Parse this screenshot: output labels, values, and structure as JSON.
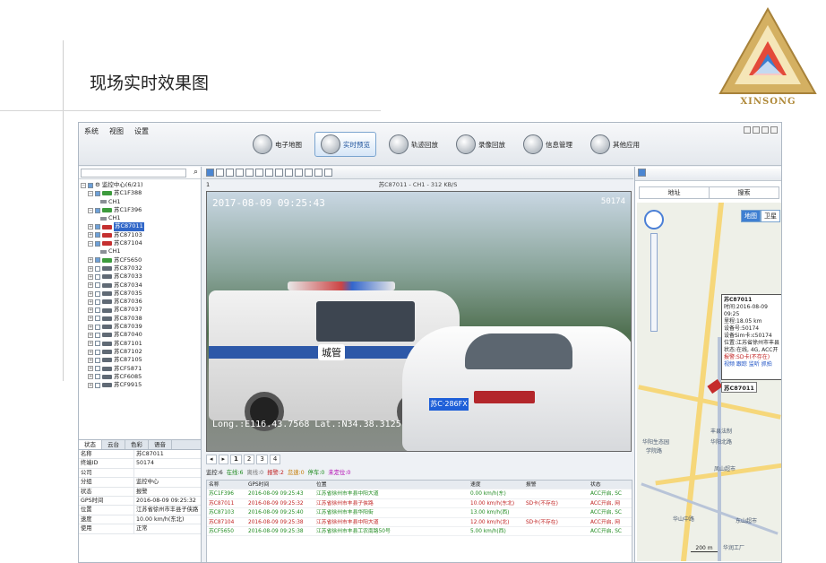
{
  "slide": {
    "title": "现场实时效果图",
    "logo_text": "XINSONG"
  },
  "colors": {
    "accent": "#3167c8",
    "alarm": "#c02020",
    "online": "#1e8a1e",
    "logo_gold": "#c9a24a"
  },
  "menu": [
    "系统",
    "视图",
    "设置"
  ],
  "nav_tabs": [
    {
      "label": "电子地图",
      "icon": "globe-icon"
    },
    {
      "label": "实时预览",
      "icon": "monitor-icon",
      "active": true
    },
    {
      "label": "轨迹回放",
      "icon": "track-icon"
    },
    {
      "label": "录像回放",
      "icon": "video-icon"
    },
    {
      "label": "信息管理",
      "icon": "info-icon"
    },
    {
      "label": "其他应用",
      "icon": "apps-icon"
    }
  ],
  "tree": {
    "root": "监控中心(6/21)",
    "nodes": [
      {
        "label": "苏C1F388",
        "status": "online",
        "expanded": true
      },
      {
        "label": "CH1",
        "type": "channel"
      },
      {
        "label": "苏C1F396",
        "status": "online",
        "expanded": true
      },
      {
        "label": "CH1",
        "type": "channel"
      },
      {
        "label": "苏C87011",
        "status": "alarm",
        "selected": true
      },
      {
        "label": "苏C87103",
        "status": "alarm"
      },
      {
        "label": "苏C87104",
        "status": "alarm",
        "expanded": true
      },
      {
        "label": "CH1",
        "type": "channel"
      },
      {
        "label": "苏CF5650",
        "status": "online"
      },
      {
        "label": "苏C87032",
        "status": "offline"
      },
      {
        "label": "苏C87033",
        "status": "offline"
      },
      {
        "label": "苏C87034",
        "status": "offline"
      },
      {
        "label": "苏C87035",
        "status": "offline"
      },
      {
        "label": "苏C87036",
        "status": "offline"
      },
      {
        "label": "苏C87037",
        "status": "offline"
      },
      {
        "label": "苏C87038",
        "status": "offline"
      },
      {
        "label": "苏C87039",
        "status": "offline"
      },
      {
        "label": "苏C87040",
        "status": "offline"
      },
      {
        "label": "苏C87101",
        "status": "offline"
      },
      {
        "label": "苏C87102",
        "status": "offline"
      },
      {
        "label": "苏C87105",
        "status": "offline"
      },
      {
        "label": "苏CF5871",
        "status": "offline"
      },
      {
        "label": "苏CF6085",
        "status": "offline"
      },
      {
        "label": "苏CF9915",
        "status": "offline"
      }
    ]
  },
  "info_tabs": [
    "状态",
    "云台",
    "色彩",
    "语音"
  ],
  "info": [
    {
      "k": "名称",
      "v": "苏C87011"
    },
    {
      "k": "终端ID",
      "v": "50174"
    },
    {
      "k": "公司",
      "v": ""
    },
    {
      "k": "分组",
      "v": "监控中心"
    },
    {
      "k": "状态",
      "v": "报警"
    },
    {
      "k": "GPS时间",
      "v": "2016-08-09 09:25:32"
    },
    {
      "k": "位置",
      "v": "江苏省徐州市丰县子侠路"
    },
    {
      "k": "速度",
      "v": "10.00 km/h(东北)"
    },
    {
      "k": "使用",
      "v": "正常"
    }
  ],
  "video": {
    "index": "1",
    "channel_title": "苏C87011 - CH1 - 312 KB/S",
    "timestamp": "2017-08-09 09:25:43",
    "device": "50174",
    "gps": "Long.:E116.43.7568 Lat.:N34.38.3125",
    "truck_badge": "城管",
    "plate": "苏C·286FX"
  },
  "pager": [
    "1",
    "2",
    "3",
    "4"
  ],
  "stats": [
    {
      "t": "监控:6",
      "c": ""
    },
    {
      "t": "在线:6",
      "c": "g"
    },
    {
      "t": "离线:0",
      "c": "gr"
    },
    {
      "t": "报警:2",
      "c": "r"
    },
    {
      "t": "怠速:0",
      "c": "o"
    },
    {
      "t": "停车:0",
      "c": "g"
    },
    {
      "t": "未定位:0",
      "c": "p"
    }
  ],
  "grid": {
    "headers": [
      "名称",
      "GPS时间",
      "位置",
      "速度",
      "报警",
      "状态"
    ],
    "rows": [
      {
        "c": [
          "苏C1F396",
          "2016-08-09 09:25:43",
          "江苏省徐州市丰县中阳大道",
          "0.00 km/h(东)",
          "",
          "ACC开启, SC"
        ],
        "style": "green"
      },
      {
        "c": [
          "苏C87011",
          "2016-08-09 09:25:32",
          "江苏省徐州市丰县子侠路",
          "10.00 km/h(东北)",
          "SD卡(不存在)",
          "ACC开启, 网"
        ],
        "style": "red"
      },
      {
        "c": [
          "苏C87103",
          "2016-08-09 09:25:40",
          "江苏省徐州市丰县华阳街",
          "13.00 km/h(西)",
          "",
          "ACC开启, SC"
        ],
        "style": "green"
      },
      {
        "c": [
          "苏C87104",
          "2016-08-09 09:25:38",
          "江苏省徐州市丰县中阳大道",
          "12.00 km/h(北)",
          "SD卡(不存在)",
          "ACC开启, 网"
        ],
        "style": "red"
      },
      {
        "c": [
          "苏CF5650",
          "2016-08-09 09:25:38",
          "江苏省徐州市丰县工农南路50号",
          "5.00 km/h(西)",
          "",
          "ACC开启, SC"
        ],
        "style": "green"
      }
    ]
  },
  "map": {
    "address_label": "地址",
    "search_label": "搜索",
    "map_types": [
      "地图",
      "卫星"
    ],
    "popup": {
      "title": "苏C87011",
      "lines": [
        "时间:2016-08-09 09:25",
        "里程:18.05 km",
        "设备号:50174",
        "设备Sim卡:c50174",
        "位置:江苏省徐州市丰县",
        "状态:在线, 4G, ACC开",
        "报警:SD卡(不存在)"
      ],
      "links": "视频 跟踪 监听 抓拍"
    },
    "marker_label": "苏C87011",
    "places": [
      "华阳北路",
      "丰县法制",
      "华阳生态园",
      "东山超市",
      "华山中路",
      "学院路",
      "凤山超市",
      "华润工厂"
    ],
    "scale": "200 m"
  }
}
